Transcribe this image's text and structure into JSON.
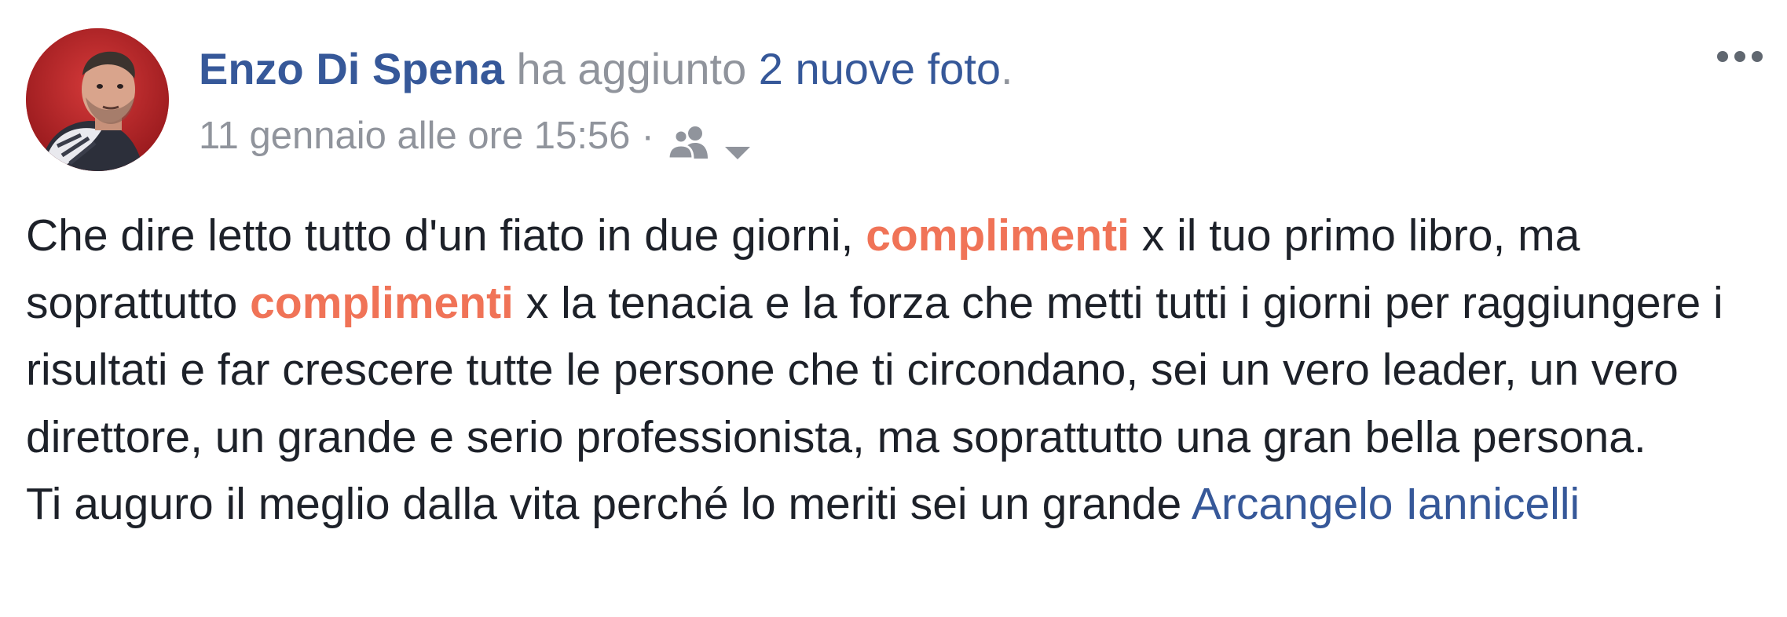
{
  "post": {
    "author": "Enzo Di Spena",
    "action_text": " ha aggiunto ",
    "photos_link": "2 nuove foto",
    "period": ".",
    "timestamp": "11 gennaio alle ore 15:56",
    "separator": "·",
    "audience_icon": "friends-icon",
    "audience_caret_icon": "caret-down-icon",
    "more_icon": "more-dots-icon",
    "body": {
      "p1_s1": "Che dire letto tutto d'un fiato in due giorni, ",
      "p1_h1": "complimenti",
      "p1_s2": " x il tuo primo libro, ma soprattutto ",
      "p1_h2": "complimenti",
      "p1_s3": " x la tenacia e la forza che metti tutti i giorni per raggiungere i risultati e far crescere tutte le persone che ti circondano, sei un vero leader, un vero direttore, un grande e serio professionista, ma soprattutto una gran bella persona.",
      "p2_s1": "Ti auguro il meglio dalla vita perché lo meriti sei un grande ",
      "p2_mention": "Arcangelo Iannicelli"
    }
  },
  "colors": {
    "link": "#365899",
    "meta": "#90949c",
    "text": "#1d2129",
    "highlight": "#f07357"
  }
}
